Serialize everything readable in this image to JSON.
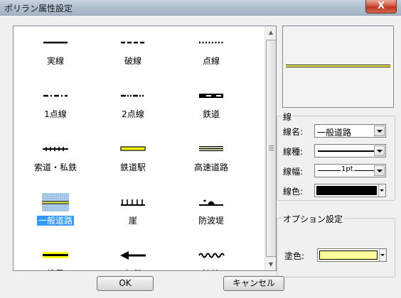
{
  "window": {
    "title": "ポリラン属性設定",
    "close_label": "X"
  },
  "palette": {
    "items": [
      {
        "label": "実線",
        "style": "solid"
      },
      {
        "label": "破線",
        "style": "dashed"
      },
      {
        "label": "点線",
        "style": "dotted"
      },
      {
        "label": "1点線",
        "style": "dashdot"
      },
      {
        "label": "2点線",
        "style": "dashdotdot"
      },
      {
        "label": "鉄道",
        "style": "railway"
      },
      {
        "label": "索道・私鉄",
        "style": "ropeway"
      },
      {
        "label": "鉄道駅",
        "style": "station"
      },
      {
        "label": "高速道路",
        "style": "expressway"
      },
      {
        "label": "一般道路",
        "style": "general-road",
        "selected": true
      },
      {
        "label": "崖",
        "style": "cliff"
      },
      {
        "label": "防波堤",
        "style": "breakwater"
      },
      {
        "label": "境界",
        "style": "boundary"
      },
      {
        "label": "矢印",
        "style": "arrow"
      },
      {
        "label": "波線",
        "style": "wave"
      }
    ]
  },
  "scrollbar": {
    "up_icon": "arrow-up-icon",
    "down_icon": "arrow-down-icon"
  },
  "line_group": {
    "legend": "線",
    "name_label": "線名:",
    "name_value": "一般道路",
    "type_label": "線種:",
    "width_label": "線幅:",
    "width_value": "1pt",
    "color_label": "線色:",
    "color_value": "#000000"
  },
  "option_group": {
    "legend": "オプション設定",
    "fill_label": "塗色:",
    "fill_value": "#ffff99"
  },
  "buttons": {
    "ok": "OK",
    "cancel": "キャンセル"
  },
  "colors": {
    "road_fill": "#ffff40",
    "selection": "#3399ff"
  }
}
